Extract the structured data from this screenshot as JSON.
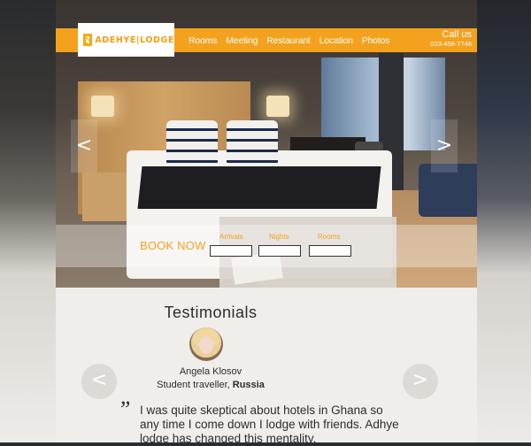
{
  "brand": {
    "name": "ADEHYE|LODGE"
  },
  "nav": {
    "items": [
      {
        "label": "Rooms"
      },
      {
        "label": "Meeting"
      },
      {
        "label": "Restaurant"
      },
      {
        "label": "Location"
      },
      {
        "label": "Photos"
      }
    ],
    "call_label": "Call us",
    "phone": "023-456-7746"
  },
  "hero": {
    "prev_symbol": "<",
    "next_symbol": ">"
  },
  "booking": {
    "cta": "BOOK NOW",
    "fields": [
      {
        "label": "Arrivals",
        "value": ""
      },
      {
        "label": "Nights",
        "value": ""
      },
      {
        "label": "Rooms",
        "value": ""
      }
    ]
  },
  "testimonials": {
    "title": "Testimonials",
    "name": "Angela Klosov",
    "role": "Student traveller,",
    "country": "Russia",
    "quote_mark": "”",
    "quote": "I was quite skeptical about hotels in Ghana so any time I come down I lodge with friends. Adhye lodge has changed this mentality.",
    "prev_symbol": "<",
    "next_symbol": ">"
  },
  "colors": {
    "accent": "#f4a11e",
    "section_bg": "#efeeea",
    "text": "#2d2d2d"
  }
}
